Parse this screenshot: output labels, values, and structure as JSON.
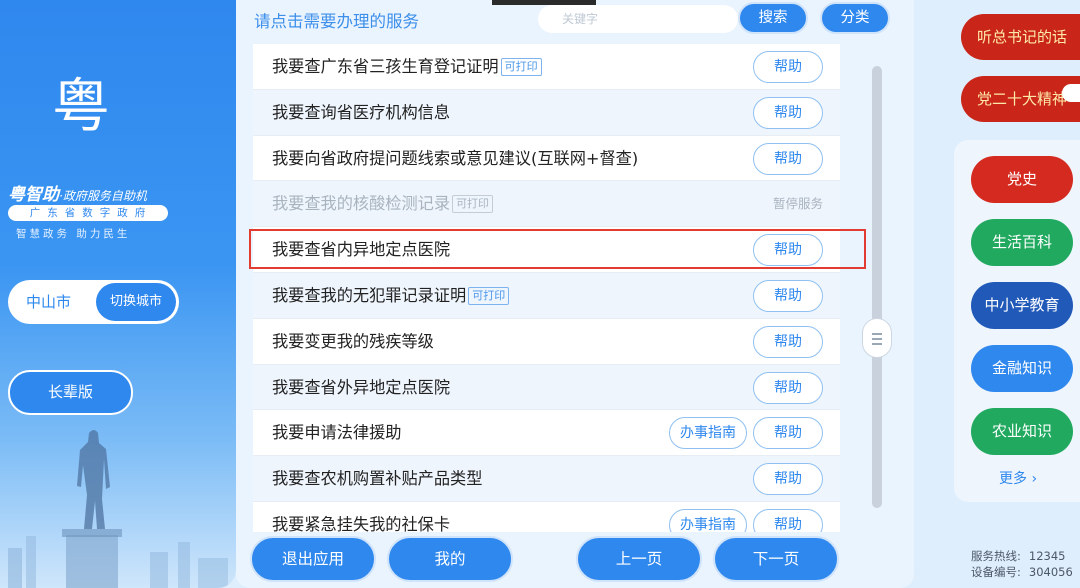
{
  "sidebar": {
    "logo_text": "粤",
    "brand_main": "粤智助",
    "brand_sub": "·政府服务自助机",
    "brand_pill": "广东省数字政府",
    "slogan": "智慧政务  助力民生",
    "city": "中山市",
    "switch_city_label": "切换城市",
    "elder_mode_label": "长辈版"
  },
  "header": {
    "title": "请点击需要办理的服务",
    "search_placeholder": "关键字",
    "search_label": "搜索",
    "category_label": "分类"
  },
  "services": [
    {
      "label": "我要查广东省三孩生育登记证明",
      "tag": "可打印",
      "help": "帮助",
      "guide": "",
      "status": ""
    },
    {
      "label": "我要查询省医疗机构信息",
      "tag": "",
      "help": "帮助",
      "guide": "",
      "status": ""
    },
    {
      "label": "我要向省政府提问题线索或意见建议(互联网+督查)",
      "tag": "",
      "help": "帮助",
      "guide": "",
      "status": ""
    },
    {
      "label": "我要查我的核酸检测记录",
      "tag": "可打印",
      "help": "",
      "guide": "",
      "status": "暂停服务"
    },
    {
      "label": "我要查省内异地定点医院",
      "tag": "",
      "help": "帮助",
      "guide": "",
      "status": ""
    },
    {
      "label": "我要查我的无犯罪记录证明",
      "tag": "可打印",
      "help": "帮助",
      "guide": "",
      "status": ""
    },
    {
      "label": "我要变更我的残疾等级",
      "tag": "",
      "help": "帮助",
      "guide": "",
      "status": ""
    },
    {
      "label": "我要查省外异地定点医院",
      "tag": "",
      "help": "帮助",
      "guide": "",
      "status": ""
    },
    {
      "label": "我要申请法律援助",
      "tag": "",
      "help": "帮助",
      "guide": "办事指南",
      "status": ""
    },
    {
      "label": "我要查农机购置补贴产品类型",
      "tag": "",
      "help": "帮助",
      "guide": "",
      "status": ""
    },
    {
      "label": "我要紧急挂失我的社保卡",
      "tag": "",
      "help": "帮助",
      "guide": "办事指南",
      "status": ""
    }
  ],
  "footer": {
    "exit_label": "退出应用",
    "mine_label": "我的",
    "prev_label": "上一页",
    "next_label": "下一页"
  },
  "right": {
    "party_btn_1": "听总书记的话",
    "party_btn_2": "党二十大精神",
    "categories": [
      {
        "label": "党史",
        "color": "#d52a1f"
      },
      {
        "label": "生活百科",
        "color": "#20a95f"
      },
      {
        "label": "中小学教育",
        "color": "#2159b8"
      },
      {
        "label": "金融知识",
        "color": "#2f88ee"
      },
      {
        "label": "农业知识",
        "color": "#20a95f"
      }
    ],
    "more_label": "更多 ›",
    "hotline_label": "服务热线:",
    "hotline_value": "12345",
    "device_label": "设备编号:",
    "device_value": "304056"
  },
  "colors": {
    "accent": "#2f88ee",
    "highlight": "#e23b32",
    "party": "#c92518"
  }
}
